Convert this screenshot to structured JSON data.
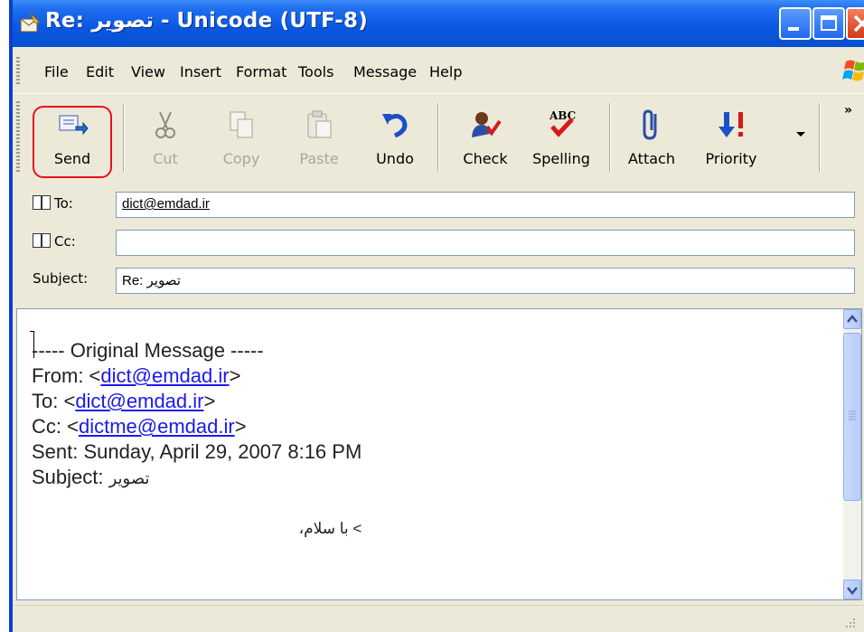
{
  "window": {
    "title": "Re: تصویر - Unicode (UTF-8)"
  },
  "menu": [
    "File",
    "Edit",
    "View",
    "Insert",
    "Format",
    "Tools",
    "Message",
    "Help"
  ],
  "toolbar": {
    "send": "Send",
    "cut": "Cut",
    "copy": "Copy",
    "paste": "Paste",
    "undo": "Undo",
    "check": "Check",
    "spelling": "Spelling",
    "attach": "Attach",
    "priority": "Priority",
    "overflow": "»"
  },
  "headers": {
    "to_label": "To:",
    "to_value": "dict@emdad.ir",
    "cc_label": "Cc:",
    "cc_value": "",
    "subject_label": "Subject:",
    "subject_value": "Re: تصویر"
  },
  "body": {
    "original_header": "----- Original Message -----",
    "from_label": "From: <",
    "from_email": "dict@emdad.ir",
    "to_label": "To: <",
    "to_email": "dict@emdad.ir",
    "cc_label": "Cc: <",
    "cc_email": "dictme@emdad.ir",
    "close_bracket": ">",
    "sent": "Sent: Sunday, April 29, 2007 8:16 PM",
    "subject_label": "Subject: ",
    "subject_value": "تصویر",
    "quote_line": "> با سلام،"
  },
  "colors": {
    "titlebar": "#0a57e0",
    "chrome": "#ece9d8",
    "link": "#1a1aee",
    "highlight_ring": "#e8101a"
  }
}
